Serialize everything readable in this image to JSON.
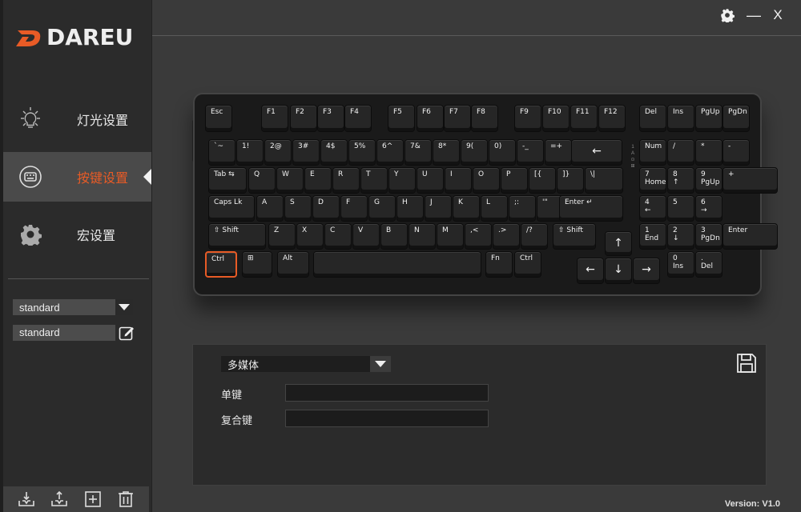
{
  "brand": {
    "name": "DAREU",
    "accent": "#e85b26"
  },
  "window": {
    "settings_icon": "gear-icon",
    "minimize_label": "—",
    "close_label": "X"
  },
  "nav": {
    "items": [
      {
        "label": "灯光设置",
        "icon": "bulb-icon",
        "active": false
      },
      {
        "label": "按键设置",
        "icon": "keyboard-icon",
        "active": true
      },
      {
        "label": "宏设置",
        "icon": "gear-icon",
        "active": false
      }
    ]
  },
  "profile": {
    "selected": "standard",
    "name": "standard"
  },
  "sidebar_actions": [
    "import-icon",
    "export-icon",
    "add-icon",
    "trash-icon"
  ],
  "keyboard": {
    "row0": [
      "Esc",
      "F1",
      "F2",
      "F3",
      "F4",
      "F5",
      "F6",
      "F7",
      "F8",
      "F9",
      "F10",
      "F11",
      "F12",
      "Del",
      "Ins",
      "PgUp",
      "PgDn"
    ],
    "row1": [
      "`~",
      "1!",
      "2@",
      "3#",
      "4$",
      "5%",
      "6^",
      "7&",
      "8*",
      "9(",
      "0)",
      "-_",
      "=+",
      "←",
      "Num",
      "/",
      "*",
      "-"
    ],
    "row2": [
      "Tab ⇆",
      "Q",
      "W",
      "E",
      "R",
      "T",
      "Y",
      "U",
      "I",
      "O",
      "P",
      "[{",
      "]}",
      "\\|",
      "7\nHome",
      "8\n↑",
      "9\nPgUp",
      "+"
    ],
    "row3": [
      "Caps Lk",
      "A",
      "S",
      "D",
      "F",
      "G",
      "H",
      "J",
      "K",
      "L",
      ";:",
      "'\"",
      "Enter ↵",
      "4\n←",
      "5",
      "6\n→"
    ],
    "row4": [
      "⇧ Shift",
      "Z",
      "X",
      "C",
      "V",
      "B",
      "N",
      "M",
      ",<",
      ".>",
      "/?",
      "⇧ Shift",
      "↑",
      "1\nEnd",
      "2\n↓",
      "3\nPgDn",
      "Enter"
    ],
    "row5": [
      "Ctrl",
      "⊞",
      "Alt",
      "",
      "Fn",
      "Ctrl",
      "←",
      "↓",
      "→",
      "0\nIns",
      ".\nDel"
    ],
    "selected_key": "Ctrl"
  },
  "mapping": {
    "type_selected": "多媒体",
    "single_key_label": "单键",
    "single_key_value": "",
    "combo_key_label": "复合键",
    "combo_key_value": ""
  },
  "version": "Version:  V1.0"
}
